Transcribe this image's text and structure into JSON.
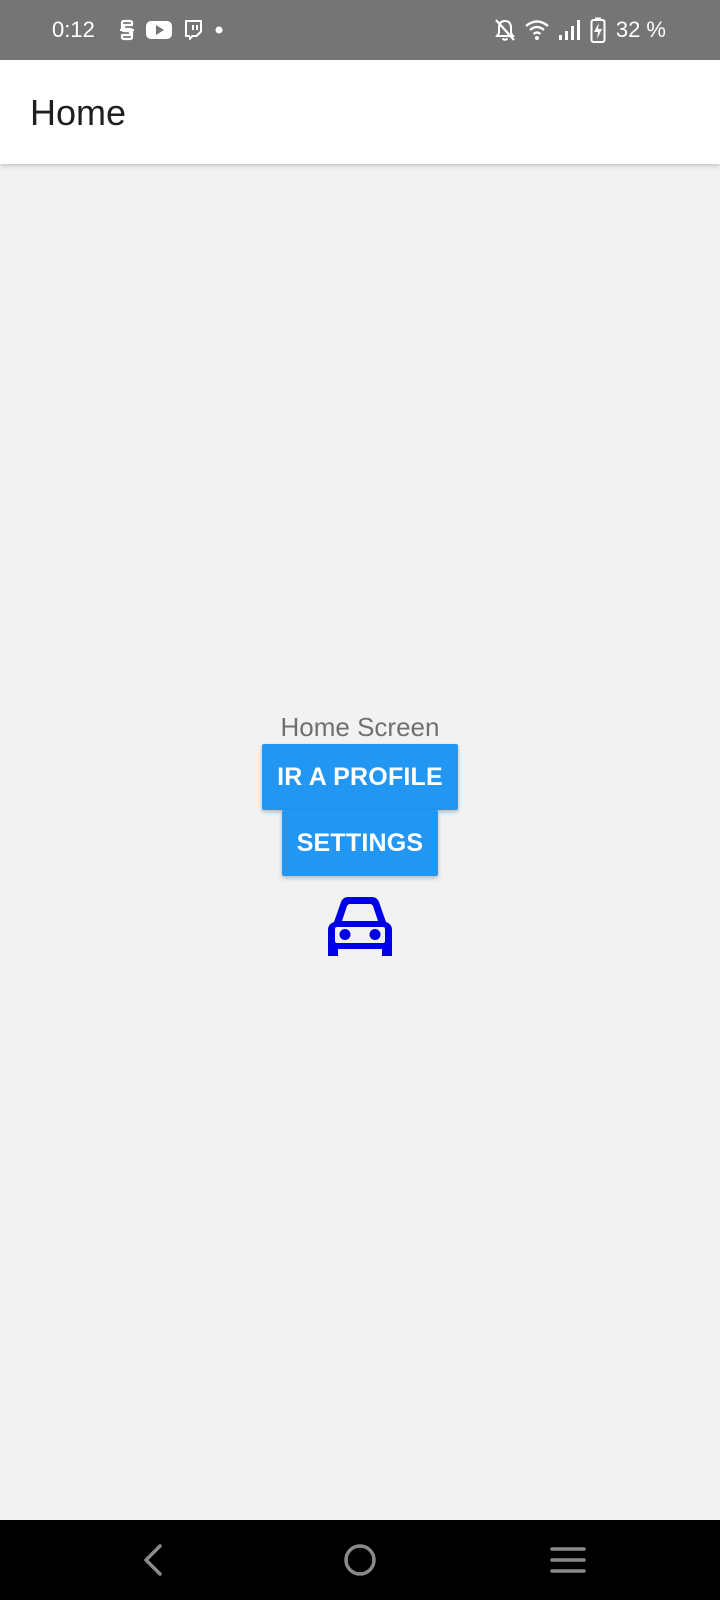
{
  "status_bar": {
    "time": "0:12",
    "battery_percent": "32 %",
    "icons_left": [
      "s-notification-icon",
      "youtube-icon",
      "twitch-icon",
      "dot-icon"
    ],
    "icons_right": [
      "bell-off-icon",
      "wifi-icon",
      "signal-icon",
      "battery-charging-icon"
    ]
  },
  "app_bar": {
    "title": "Home"
  },
  "main": {
    "screen_label": "Home Screen",
    "profile_button_label": "IR A PROFILE",
    "settings_button_label": "SETTINGS",
    "center_icon": "car-icon"
  },
  "nav_bar": {
    "items": [
      "back-icon",
      "home-icon",
      "recents-icon"
    ]
  },
  "colors": {
    "status_bar_bg": "#757575",
    "app_bar_bg": "#ffffff",
    "content_bg": "#f2f2f2",
    "button_bg": "#2196f3",
    "car_icon": "#0000e6",
    "nav_bar_bg": "#000000"
  }
}
